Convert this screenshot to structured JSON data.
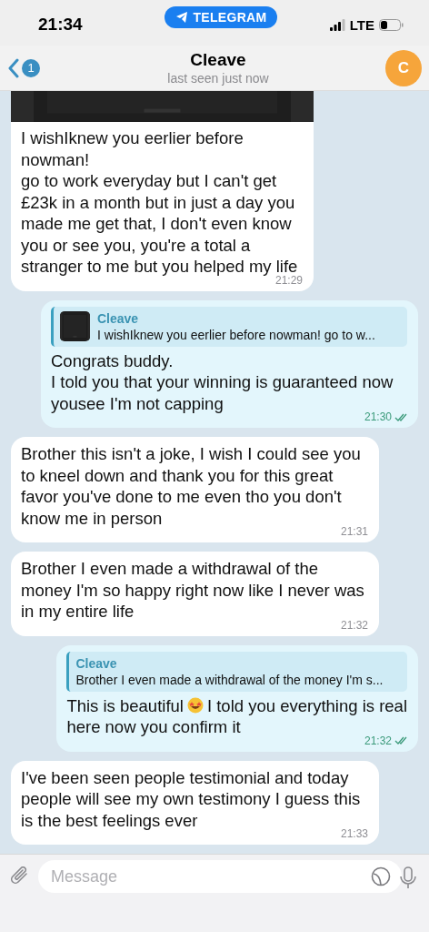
{
  "status_bar": {
    "time": "21:34",
    "app_pill": "TELEGRAM",
    "network": "LTE"
  },
  "header": {
    "back_badge": "1",
    "title": "Cleave",
    "subtitle": "last seen just now",
    "avatar_letter": "C"
  },
  "messages": [
    {
      "kind": "incoming",
      "photo": true,
      "text": "I wishIknew you eerlier before nowman!\ngo to work everyday but I can't get £23k in a month but in just a day you made me get that, I don't even know you or see you, you're a total a stranger to me but you helped my life",
      "time": "21:29",
      "read": false
    },
    {
      "kind": "outgoing",
      "reply": {
        "author": "Cleave",
        "text": "I wishIknew you eerlier before nowman! go to w...",
        "thumbnail": true
      },
      "text": "Congrats buddy.\nI told you that your winning is guaranteed now yousee I'm not capping",
      "time": "21:30",
      "read": true
    },
    {
      "kind": "incoming",
      "text": "Brother this isn't a joke, I wish I could see you to kneel down and thank you for this great favor you've done to me even tho you don't know me in person",
      "time": "21:31",
      "read": false
    },
    {
      "kind": "incoming",
      "text": "Brother I even made a withdrawal of the money I'm so happy right now like I never was in my entire life",
      "time": "21:32",
      "read": false
    },
    {
      "kind": "outgoing",
      "reply": {
        "author": "Cleave",
        "text": "Brother I even made a withdrawal of the money I'm s...",
        "thumbnail": false
      },
      "text": [
        "This is beautiful",
        "I told you everything is real",
        "here now you confirm it"
      ],
      "time": "21:32",
      "read": true
    },
    {
      "kind": "incoming",
      "text": "I've been seen people testimonial and today people will see my own testimony I guess this is the best feelings ever",
      "time": "21:33",
      "read": false
    }
  ],
  "composer": {
    "placeholder": "Message"
  }
}
